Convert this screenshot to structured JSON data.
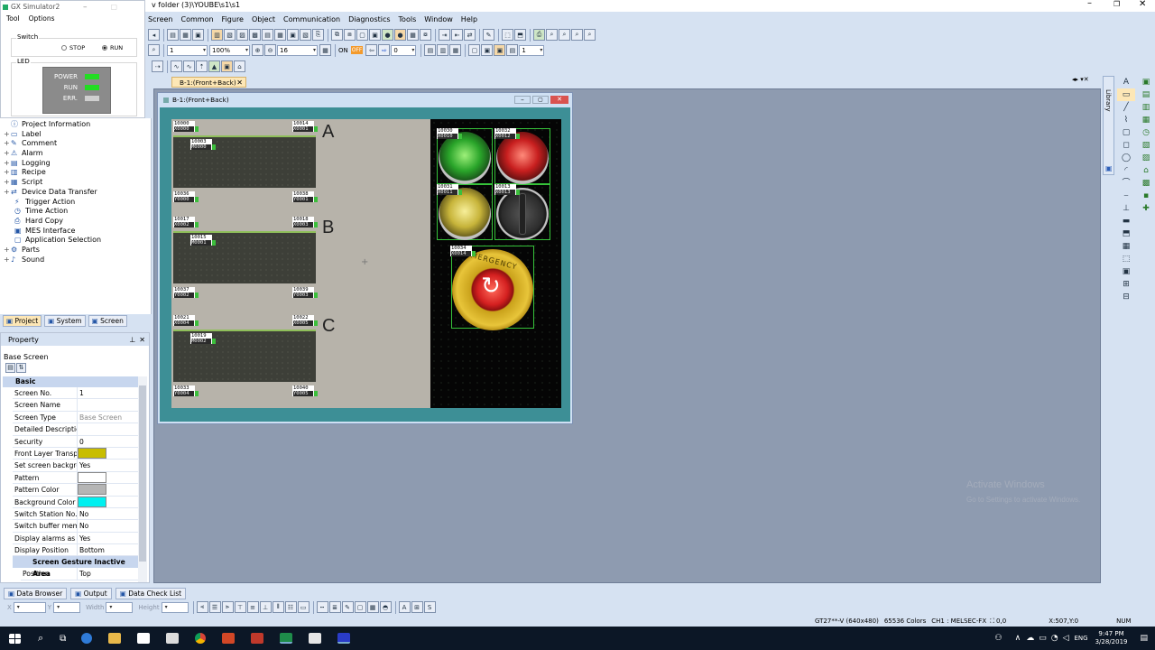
{
  "app": {
    "title_path": "v folder (3)\\YOUBE\\s1\\s1"
  },
  "menu": [
    "Screen",
    "Common",
    "Figure",
    "Object",
    "Communication",
    "Diagnostics",
    "Tools",
    "Window",
    "Help"
  ],
  "toolbar": {
    "screen_no": "1",
    "zoom": "100%",
    "grid": "16",
    "on_label": "ON",
    "off_label": "OFF",
    "offset": "0",
    "layer_no": "1"
  },
  "simulator": {
    "title": "GX Simulator2",
    "menu": [
      "Tool",
      "Options"
    ],
    "switch_label": "Switch",
    "stop_label": "STOP",
    "run_label": "RUN",
    "selected": "RUN",
    "led_label": "LED",
    "leds": [
      {
        "name": "POWER",
        "color": "#22dd22"
      },
      {
        "name": "RUN",
        "color": "#22dd22"
      },
      {
        "name": "ERR.",
        "color": "#cfcfcf"
      }
    ]
  },
  "tree": [
    {
      "label": "Project Information",
      "icon": "info-icon",
      "pm": ""
    },
    {
      "label": "Label",
      "icon": "label-icon",
      "pm": "+"
    },
    {
      "label": "Comment",
      "icon": "comment-icon",
      "pm": "+"
    },
    {
      "label": "Alarm",
      "icon": "alarm-icon",
      "pm": "+"
    },
    {
      "label": "Logging",
      "icon": "logging-icon",
      "pm": "+"
    },
    {
      "label": "Recipe",
      "icon": "recipe-icon",
      "pm": "+"
    },
    {
      "label": "Script",
      "icon": "script-icon",
      "pm": "+"
    },
    {
      "label": "Device Data Transfer",
      "icon": "device-transfer-icon",
      "pm": "+"
    },
    {
      "label": "Trigger Action",
      "icon": "trigger-icon",
      "pm": ""
    },
    {
      "label": "Time Action",
      "icon": "clock-icon",
      "pm": ""
    },
    {
      "label": "Hard Copy",
      "icon": "hardcopy-icon",
      "pm": ""
    },
    {
      "label": "MES Interface",
      "icon": "mes-icon",
      "pm": ""
    },
    {
      "label": "Application Selection",
      "icon": "application-icon",
      "pm": ""
    },
    {
      "label": "Parts",
      "icon": "parts-icon",
      "pm": "+"
    },
    {
      "label": "Sound",
      "icon": "sound-icon",
      "pm": "+"
    }
  ],
  "left_tabs": [
    "Project",
    "System",
    "Screen"
  ],
  "property": {
    "title": "Property",
    "object": "Base Screen",
    "section_basic": "Basic",
    "rows": [
      {
        "k": "Screen No.",
        "v": "1"
      },
      {
        "k": "Screen Name",
        "v": ""
      },
      {
        "k": "Screen Type",
        "v": "Base Screen",
        "dim": true
      },
      {
        "k": "Detailed Descriptio",
        "v": ""
      },
      {
        "k": "Security",
        "v": "0"
      },
      {
        "k": "Front Layer Transp",
        "v": "",
        "swatch": "#c8bd00"
      },
      {
        "k": "Set screen backgrc",
        "v": "Yes"
      },
      {
        "k": "Pattern",
        "v": "",
        "swatch": "#ffffff"
      },
      {
        "k": "Pattern Color",
        "v": "",
        "swatch": "#b5b5b5"
      },
      {
        "k": "Background Color",
        "v": "",
        "swatch": "#00f0f0"
      },
      {
        "k": "Switch Station No.",
        "v": "No"
      },
      {
        "k": "Switch buffer mem",
        "v": "No"
      },
      {
        "k": "Display alarms as pc",
        "v": "Yes"
      },
      {
        "k": "Display Position",
        "v": "Bottom"
      }
    ],
    "section_gesture": "Screen Gesture Inactive Area",
    "gesture_rows": [
      {
        "k": "Position",
        "v": "Top"
      }
    ]
  },
  "doc_tab": "B-1:(Front+Back)",
  "inner_title": "B-1:(Front+Back)",
  "panels": [
    {
      "letter": "A",
      "tl": [
        "10000",
        "X0000"
      ],
      "tr": [
        "10014",
        "X0001"
      ],
      "mid": [
        "10003",
        "M0000"
      ],
      "bl": [
        "10036",
        "Y0000"
      ],
      "br": [
        "10038",
        "Y0001"
      ]
    },
    {
      "letter": "B",
      "tl": [
        "10017",
        "X0002"
      ],
      "tr": [
        "10018",
        "X0003"
      ],
      "mid": [
        "10015",
        "M0001"
      ],
      "bl": [
        "10037",
        "Y0002"
      ],
      "br": [
        "10039",
        "Y0003"
      ]
    },
    {
      "letter": "C",
      "tl": [
        "10021",
        "X0004"
      ],
      "tr": [
        "10022",
        "X0005"
      ],
      "mid": [
        "10019",
        "M0002"
      ],
      "bl": [
        "10033",
        "Y0004"
      ],
      "br": [
        "10040",
        "Y0005"
      ]
    }
  ],
  "lamps": [
    {
      "tag": [
        "10030",
        "X0010"
      ],
      "color": "green"
    },
    {
      "tag": [
        "10032",
        "X0012"
      ],
      "color": "red"
    },
    {
      "tag": [
        "10031",
        "X0011"
      ],
      "color": "yellow"
    },
    {
      "tag": [
        "10013",
        "X0013"
      ],
      "color": "selector"
    }
  ],
  "estop": {
    "tag": [
      "10034",
      "X0014"
    ],
    "text": "EMERGENCY"
  },
  "bottom_tabs": [
    "Data Browser",
    "Output",
    "Data Check List"
  ],
  "format_bar": {
    "x_label": "X",
    "y_label": "Y",
    "width_label": "Width",
    "height_label": "Height"
  },
  "status": {
    "model": "GT27**-V (640x480)",
    "colors": "65536 Colors",
    "ch": "CH1 : MELSEC-FX",
    "coord": "0,0",
    "cursor": "X:507,Y:0",
    "num": "NUM"
  },
  "watermark": {
    "line1": "Activate Windows",
    "line2": "Go to Settings to activate Windows."
  },
  "taskbar": {
    "lang": "ENG",
    "time": "9:47 PM",
    "date": "3/28/2019"
  },
  "colors": {
    "accent": "#d6e2f2",
    "canvas": "#8e9bb0"
  }
}
